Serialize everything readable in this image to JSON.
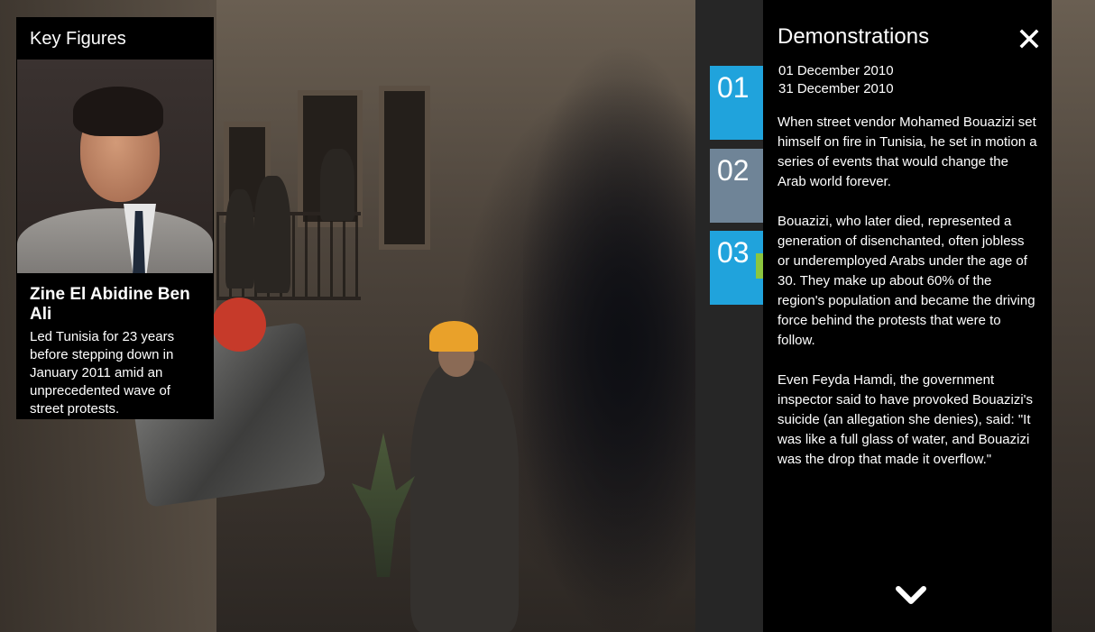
{
  "key_figure": {
    "section_title": "Key Figures",
    "name": "Zine El Abidine Ben Ali",
    "description": "Led Tunisia for 23 years before stepping down in January 2011 amid an unprecedented wave of street protests."
  },
  "nav": {
    "tabs": [
      {
        "label": "01",
        "color": "#20a3dc"
      },
      {
        "label": "02",
        "color": "#6f8497"
      },
      {
        "label": "03",
        "color": "#20a3dc"
      }
    ],
    "active_marker_color": "#8cc63f"
  },
  "panel": {
    "title": "Demonstrations",
    "close_icon": "close-icon",
    "start_date": "01 December 2010",
    "end_date": "31 December 2010",
    "paragraphs": [
      "When street vendor Mohamed Bouazizi set himself on fire in Tunisia, he set in motion a series of events that would change the Arab world forever.",
      "Bouazizi, who later died, represented a generation of disenchanted, often jobless or underemployed Arabs under the age of 30. They make up about 60% of the region's population and became the driving force behind the protests that were to follow.",
      "Even Feyda Hamdi, the government inspector said to have provoked Bouazizi's suicide (an allegation she denies), said: \"It was like a full glass of water, and Bouazizi was the drop that made it overflow.\""
    ],
    "scroll_icon": "chevron-down-icon"
  }
}
